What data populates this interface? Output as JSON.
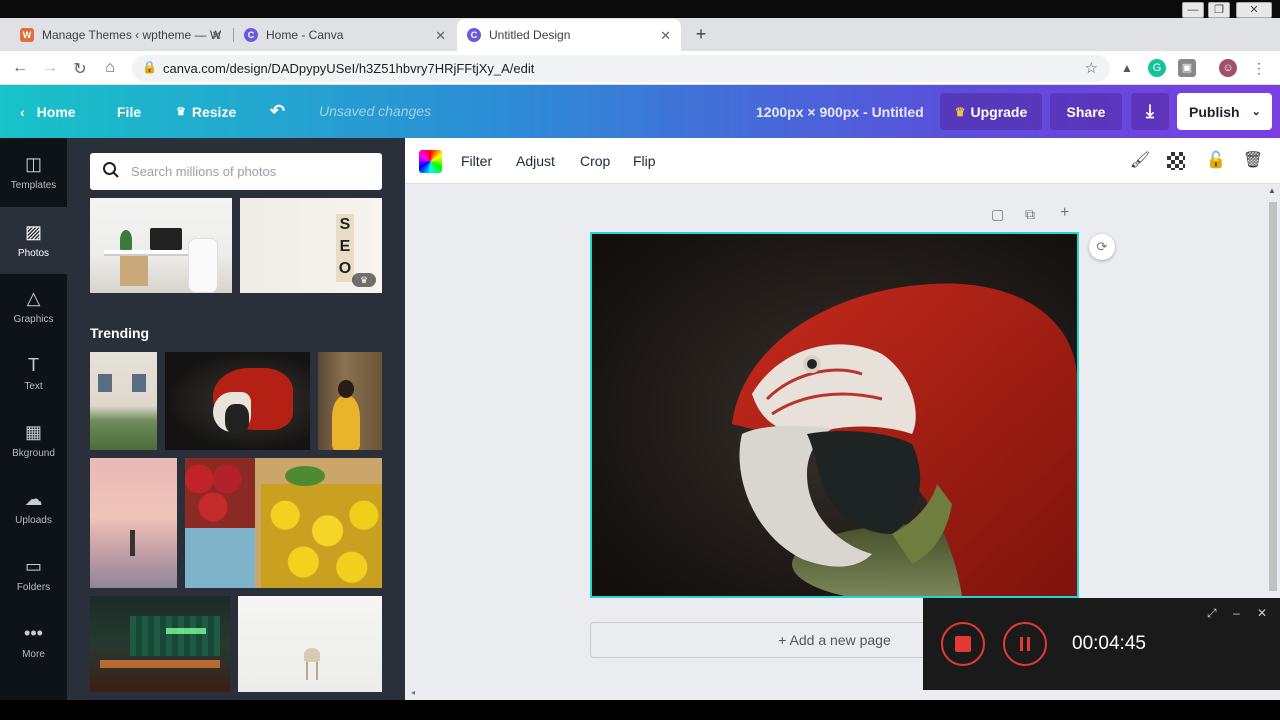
{
  "browser": {
    "tabs": [
      {
        "title": "Manage Themes ‹ wptheme — W",
        "favicon": "wordpress-icon"
      },
      {
        "title": "Home - Canva",
        "favicon": "canva-icon"
      },
      {
        "title": "Untitled Design",
        "favicon": "canva-icon"
      }
    ],
    "url": "canva.com/design/DADpypyUSeI/h3Z51hbvry7HRjFFtjXy_A/edit"
  },
  "editor": {
    "home": "Home",
    "file": "File",
    "resize": "Resize",
    "unsaved": "Unsaved changes",
    "dimensions": "1200px × 900px - Untitled",
    "upgrade": "Upgrade",
    "share": "Share",
    "publish": "Publish"
  },
  "leftnav": {
    "items": [
      {
        "label": "Templates",
        "icon": "templates-icon"
      },
      {
        "label": "Photos",
        "icon": "photos-icon"
      },
      {
        "label": "Graphics",
        "icon": "graphics-icon"
      },
      {
        "label": "Text",
        "icon": "text-icon"
      },
      {
        "label": "Bkground",
        "icon": "background-icon"
      },
      {
        "label": "Uploads",
        "icon": "uploads-icon"
      },
      {
        "label": "Folders",
        "icon": "folders-icon"
      },
      {
        "label": "More",
        "icon": "more-icon"
      }
    ]
  },
  "panel": {
    "search_placeholder": "Search millions of photos",
    "seo_letters": "S E O",
    "trending": "Trending"
  },
  "image_toolbar": {
    "filter": "Filter",
    "adjust": "Adjust",
    "crop": "Crop",
    "flip": "Flip"
  },
  "canvas": {
    "add_page": "+ Add a new page"
  },
  "recorder": {
    "time": "00:04:45"
  },
  "colors": {
    "accent": "#24d6d0",
    "brand_gradient_start": "#18c3c9",
    "brand_gradient_end": "#7a3fe0"
  }
}
